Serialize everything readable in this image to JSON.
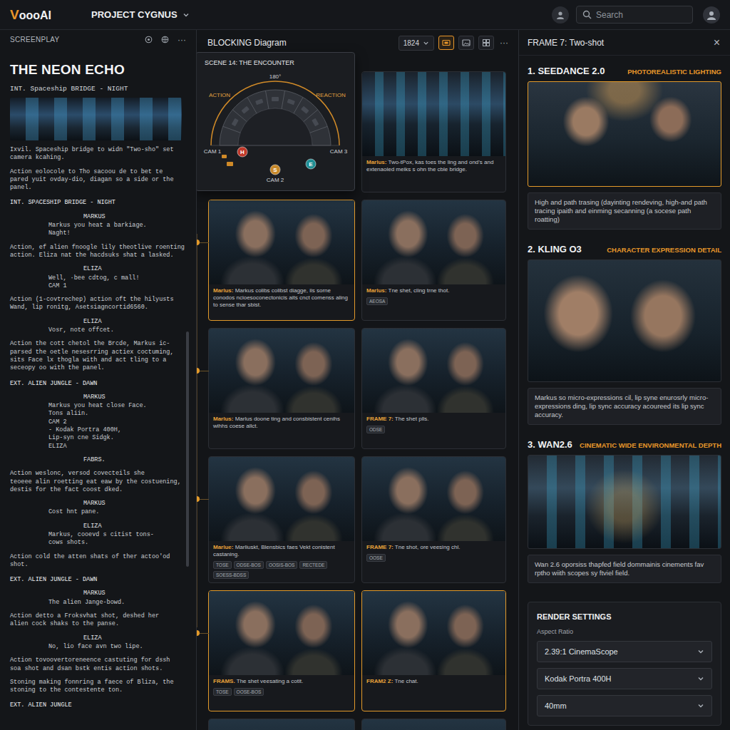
{
  "topbar": {
    "logo": {
      "initial": "V",
      "rest": "oooAI"
    },
    "project": "PROJECT CYGNUS",
    "search": {
      "placeholder": "Search"
    }
  },
  "screenplay": {
    "header": "SCREENPLAY",
    "more": "···",
    "title": "THE NEON ECHO",
    "slug": "INT. Spaceship BRIDGE - NIGHT",
    "blocks": [
      {
        "kind": "action",
        "lines": [
          "Ixvil. Spaceship bridge to widn \"Two-sho\" set",
          "camera kcahing."
        ]
      },
      {
        "kind": "action",
        "lines": [
          "Action eolocole to Tho sacoou de to bet te",
          "pared yuit ovday-dio, diagan so a side or the",
          "panel."
        ]
      },
      {
        "kind": "heading",
        "lines": [
          "INT. SPACESHIP BRIDGE - NIGHT"
        ]
      },
      {
        "kind": "character",
        "lines": [
          "MARKUS"
        ]
      },
      {
        "kind": "dialogue",
        "lines": [
          "Markus you heat a barkiage.",
          "Naght!"
        ]
      },
      {
        "kind": "action",
        "lines": [
          "Action, ef alien fnoogle lily theotlive roenting",
          "action. Eliza nat the hacdsuks shat a lasked."
        ]
      },
      {
        "kind": "character",
        "lines": [
          "ELIZA"
        ]
      },
      {
        "kind": "dialogue",
        "lines": [
          "Well, ·bee cdtog, c mall!",
          "CAM 1"
        ]
      },
      {
        "kind": "action",
        "lines": [
          "Action (1-covtrechep) action oft the hilyusts",
          "Wand, lip ronitg, Asetsiagncortid6560."
        ]
      },
      {
        "kind": "character",
        "lines": [
          "ELIZA"
        ]
      },
      {
        "kind": "dialogue",
        "lines": [
          "Vosr, note offcet."
        ]
      },
      {
        "kind": "action",
        "lines": [
          "Action the cott chetol the Brcde, Markus ic-",
          "parsed the oetle nesesrring actiex coctuming,",
          "sits Face lx thogla with and act tling to a",
          "seceopy oo with the panel."
        ]
      },
      {
        "kind": "heading",
        "lines": [
          "EXT. ALIEN JUNGLE - DAWN"
        ]
      },
      {
        "kind": "character",
        "lines": [
          "MARKUS"
        ]
      },
      {
        "kind": "dialogue",
        "lines": [
          "Markus you heat close Face.",
          "Tons aliin.",
          "CAM 2",
          "- Kodak Portra 400H,",
          "Lip-syn cne Sidgk.",
          "ELIZA"
        ]
      },
      {
        "kind": "character",
        "lines": [
          "FABRS."
        ]
      },
      {
        "kind": "action",
        "lines": [
          "Action weslonc, versod covecteils she",
          "teoeee alin roetting eat eaw by the costuening,",
          "destis for the fact coost dked."
        ]
      },
      {
        "kind": "character",
        "lines": [
          "MARKUS"
        ]
      },
      {
        "kind": "dialogue",
        "lines": [
          "Cost hnt pane."
        ]
      },
      {
        "kind": "character",
        "lines": [
          "ELIZA"
        ]
      },
      {
        "kind": "dialogue",
        "lines": [
          "Markus, cooevd s citist tons-",
          "cows shots."
        ]
      },
      {
        "kind": "action",
        "lines": [
          "Action cold the atten shats of ther actoo'od",
          "shot."
        ]
      },
      {
        "kind": "heading",
        "lines": [
          "EXT. ALIEN JUNGLE - DAWN"
        ]
      },
      {
        "kind": "character",
        "lines": [
          "MARKUS"
        ]
      },
      {
        "kind": "dialogue",
        "lines": [
          "The alien Jange-bowd."
        ]
      },
      {
        "kind": "action",
        "lines": [
          "Action detto a Froksvhat shot, deshed her",
          "alien cock shaks to the panse."
        ]
      },
      {
        "kind": "character",
        "lines": [
          "ELIZA"
        ]
      },
      {
        "kind": "dialogue",
        "lines": [
          "No, lio face avn two lipe."
        ]
      },
      {
        "kind": "action",
        "lines": [
          "Action tovoovertoreneence castuting for dssh",
          "soa shot and dsan bstk entis action shots."
        ]
      },
      {
        "kind": "action",
        "lines": [
          "Stoning making fonnring a faece of Bliza, the",
          "stoning to the contestente ton."
        ]
      },
      {
        "kind": "heading",
        "lines": [
          "EXT. ALIEN JUNGLE"
        ]
      }
    ]
  },
  "blocking": {
    "header": "BLOCKING Diagram",
    "zoom": "1824",
    "more": "···",
    "view_buttons": [
      {
        "selected": true
      },
      {
        "selected": false
      },
      {
        "selected": false
      }
    ],
    "diagram": {
      "title": "SCENE 14: THE ENCOUNTER",
      "angle": "180°",
      "left_label": "ACTION",
      "right_label": "REACTION",
      "cameras": [
        "CAM 1",
        "CAM 3",
        "CAM 2"
      ],
      "markers": [
        {
          "label": "H",
          "color": "#c0392b"
        },
        {
          "label": "E",
          "color": "#1f8f95"
        },
        {
          "label": "S",
          "color": "#c8892a"
        }
      ]
    },
    "frames": [
      {
        "selected": false,
        "speaker": "Marlus:",
        "text": "Two-tPox, kas toes the ling and ond's and extenaoled meiks s ohn the cble bridge.",
        "tags": []
      },
      {
        "selected": true,
        "speaker": "Marlus:",
        "text": "Markus colibs colibst diagge, iis sorne conodos ncioesoconectonicis aits cnct comenss aling to sense thar sbist.",
        "tags": []
      },
      {
        "selected": false,
        "speaker": "Marlus:",
        "text": "Tne shet, cling trne thot.",
        "tags": [
          "AEOSA"
        ]
      },
      {
        "selected": false,
        "speaker": "Marlus:",
        "text": "Marlus doone ting and consbistent cenihs wihhs coese allct.",
        "tags": []
      },
      {
        "selected": false,
        "speaker": "FRAME 7:",
        "text": "The shet plls.",
        "tags": [
          "ODSE"
        ]
      },
      {
        "selected": false,
        "speaker": "Marlue:",
        "text": "Marliuskt, Blensbics faes Vekt conistent castaning.",
        "tags": [
          "TOSE",
          "ODSE-BOS",
          "OOSIS-BOS",
          "RECTEDE",
          "SOESS-BDSS"
        ]
      },
      {
        "selected": false,
        "speaker": "FRAME 7:",
        "text": "Tne shot, ore veesing chl.",
        "tags": [
          "OOSE"
        ]
      },
      {
        "selected": true,
        "speaker": "FRAMS.",
        "text": "The shet veesating a cotit.",
        "tags": [
          "TOSE",
          "OOSE-BOS"
        ]
      },
      {
        "selected": true,
        "speaker": "FRAM2 Z:",
        "text": "Tne chat.",
        "tags": []
      },
      {
        "selected": false
      },
      {
        "selected": false
      }
    ]
  },
  "inspector": {
    "title": "FRAME 7: Two-shot",
    "close": "×",
    "models": [
      {
        "name": "1. SEEDANCE 2.0",
        "tag": "PHOTOREALISTIC LIGHTING",
        "selected": true,
        "description": "High and path trasing (dayinting rendeving, high-and path tracing ipaith and einming secanning (a socese path roatting)"
      },
      {
        "name": "2. KLING O3",
        "tag": "CHARACTER EXPRESSION DETAIL",
        "selected": false,
        "description": "Markus so micro-expressions cil, lip syne enurosrly micro-expressions ding, lip sync accuracy acoureed its lip sync accuracy."
      },
      {
        "name": "3. WAN2.6",
        "tag": "CINEMATIC WIDE ENVIRONMENTAL DEPTH",
        "selected": false,
        "description": "Wan 2.6 oporsiss thapfed field dommainis cinements fav rptho wiith scopes sy ftviel field."
      }
    ],
    "render_settings": {
      "title": "RENDER SETTINGS",
      "label": "Aspect Ratio",
      "fields": [
        {
          "value": "2.39:1 CinemaScope"
        },
        {
          "value": "Kodak Portra 400H"
        },
        {
          "value": "40mm"
        }
      ]
    }
  }
}
